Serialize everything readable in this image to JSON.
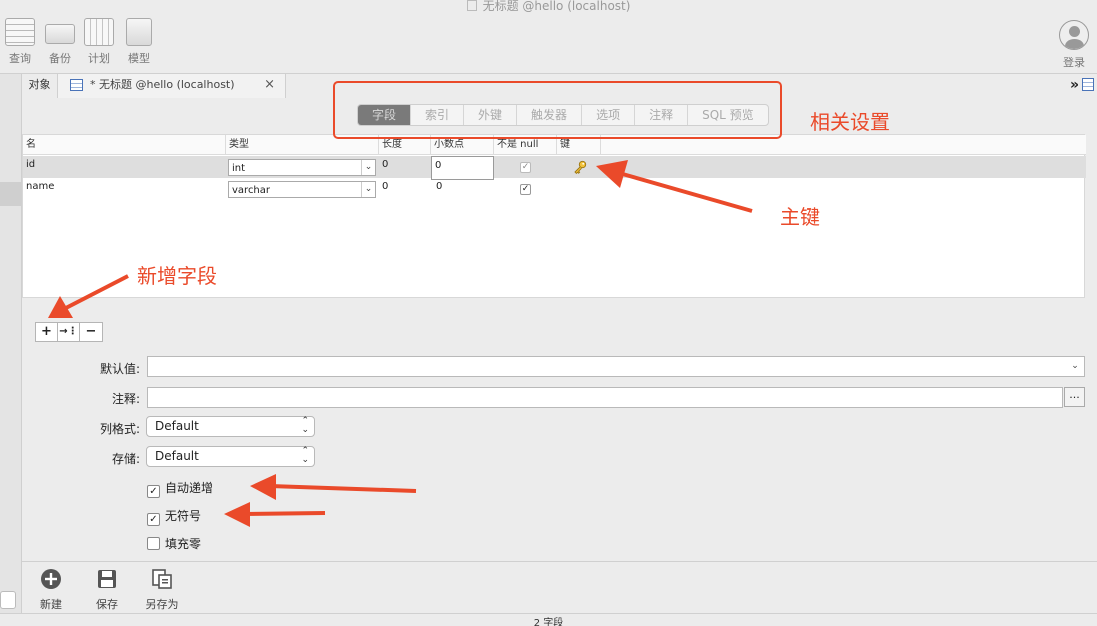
{
  "window": {
    "title": "无标题 @hello (localhost)"
  },
  "toolbar": {
    "items": [
      {
        "label": "查询",
        "icon": "table-grid-icon"
      },
      {
        "label": "备份",
        "icon": "tape-backup-icon"
      },
      {
        "label": "计划",
        "icon": "calendar-clock-icon"
      },
      {
        "label": "模型",
        "icon": "model-diagram-icon"
      }
    ],
    "login_label": "登录"
  },
  "tabs": {
    "objects_label": "对象",
    "doc_label": "* 无标题 @hello (localhost)",
    "close_glyph": "×",
    "more_glyph": "»"
  },
  "segments": {
    "items": [
      "字段",
      "索引",
      "外键",
      "触发器",
      "选项",
      "注释",
      "SQL 预览"
    ],
    "active_index": 0
  },
  "grid": {
    "headers": [
      "名",
      "类型",
      "长度",
      "小数点",
      "不是 null",
      "键"
    ],
    "rows": [
      {
        "name": "id",
        "type": "int",
        "length": "0",
        "decimals": "0",
        "not_null": true,
        "key": true
      },
      {
        "name": "name",
        "type": "varchar",
        "length": "0",
        "decimals": "0",
        "not_null": true,
        "key": false
      }
    ],
    "add_glyph": "+",
    "insert_glyph": "→⋮",
    "remove_glyph": "−"
  },
  "form": {
    "default_label": "默认值:",
    "default_value": "",
    "comment_label": "注释:",
    "comment_value": "",
    "ellipsis_label": "...",
    "column_format_label": "列格式:",
    "column_format_value": "Default",
    "storage_label": "存储:",
    "storage_value": "Default",
    "auto_increment_label": "自动递增",
    "auto_increment_checked": true,
    "unsigned_label": "无符号",
    "unsigned_checked": true,
    "zerofill_label": "填充零",
    "zerofill_checked": false
  },
  "bottom": {
    "new_label": "新建",
    "save_label": "保存",
    "save_as_label": "另存为"
  },
  "status": {
    "text": "2 字段"
  },
  "annotations": {
    "color": "#ea4a2a",
    "settings": "相关设置",
    "primary_key": "主键",
    "add_field": "新增字段"
  }
}
